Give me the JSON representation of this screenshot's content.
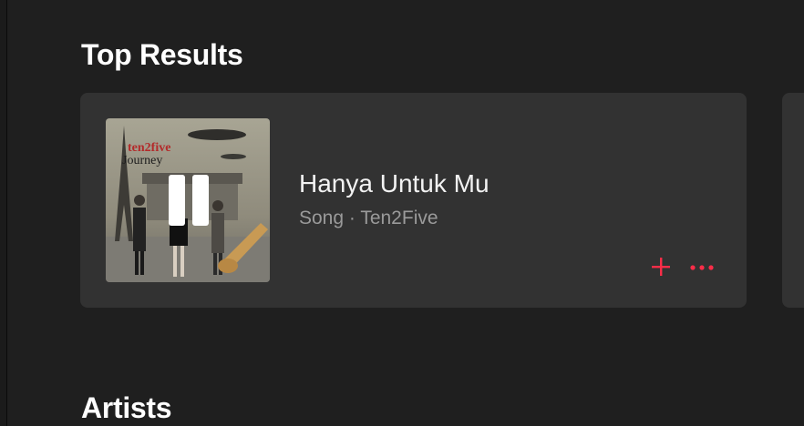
{
  "sections": {
    "top_results_title": "Top Results",
    "artists_title": "Artists"
  },
  "top_result": {
    "title": "Hanya Untuk Mu",
    "kind": "Song",
    "separator": "·",
    "artist": "Ten2Five",
    "meta": "Song · Ten2Five",
    "artwork": {
      "band_text": "ten2five",
      "album_text": "Journey"
    },
    "playback_state": "playing",
    "actions": {
      "add_icon": "plus-icon",
      "more_icon": "ellipsis-icon"
    }
  },
  "colors": {
    "background": "#1f1f1f",
    "card": "#323232",
    "accent": "#fa2d48",
    "title_text": "#f2f2f2",
    "meta_text": "#9a9a9a"
  }
}
